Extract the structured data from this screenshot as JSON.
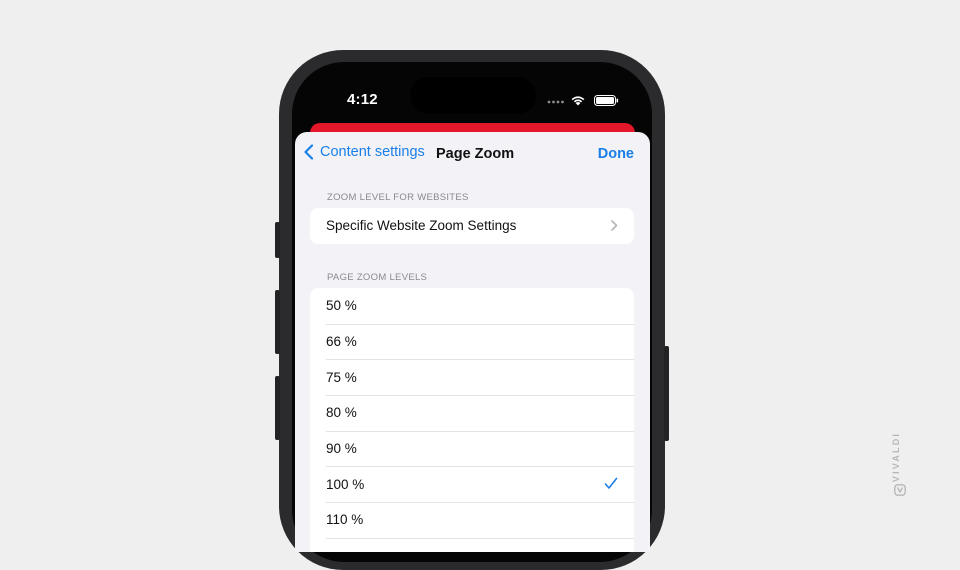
{
  "status_bar": {
    "time": "4:12",
    "icons": [
      "signal-dots-icon",
      "wifi-icon",
      "battery-icon"
    ]
  },
  "nav": {
    "back_label": "Content settings",
    "title": "Page Zoom",
    "done_label": "Done"
  },
  "sections": {
    "zoom_level": {
      "header": "ZOOM LEVEL FOR WEBSITES",
      "item": "Specific Website Zoom Settings"
    },
    "page_zoom": {
      "header": "PAGE ZOOM LEVELS",
      "items": [
        "50 %",
        "66 %",
        "75 %",
        "80 %",
        "90 %",
        "100 %",
        "110 %"
      ],
      "selected": "100 %"
    }
  },
  "watermark": "VIVALDI",
  "colors": {
    "accent": "#1a7fe8",
    "brand_red": "#e5172a",
    "background": "#efefef"
  }
}
